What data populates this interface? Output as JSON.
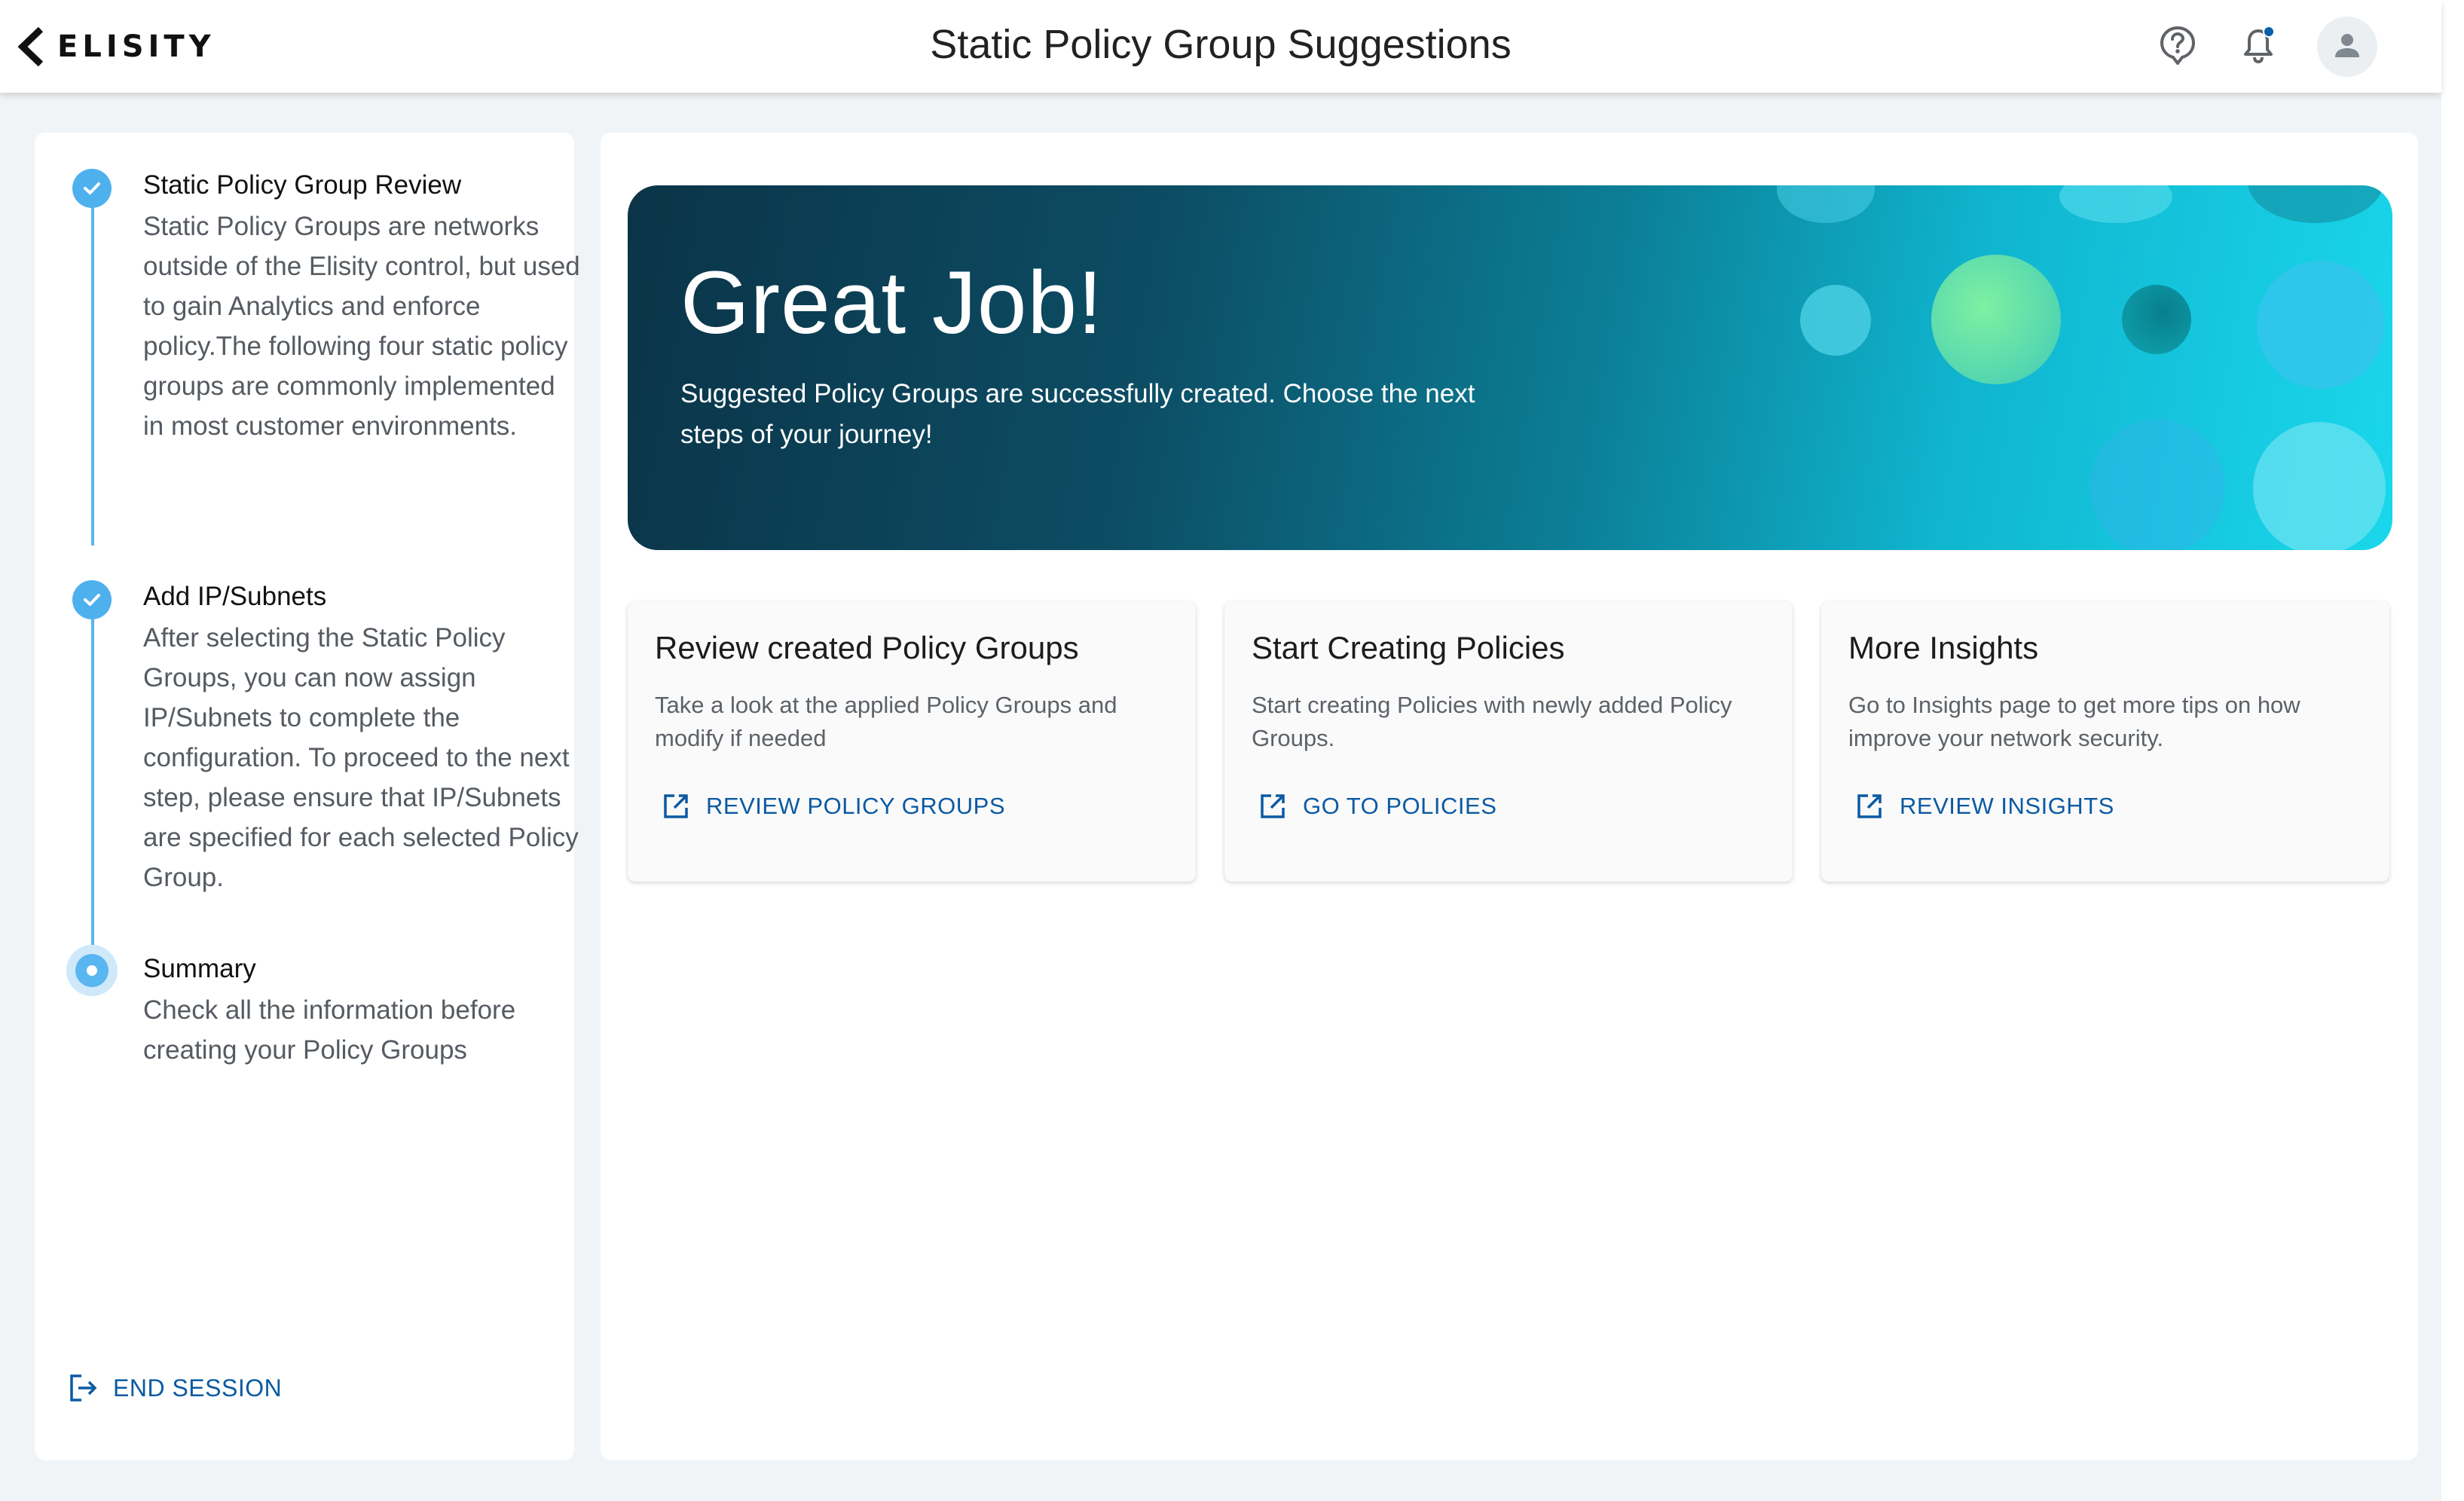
{
  "header": {
    "brand": "ELISITY",
    "title": "Static Policy Group Suggestions",
    "icons": [
      "help-icon",
      "bell-icon",
      "user-avatar-icon"
    ],
    "notification_dot_color": "#0a5fa8"
  },
  "stepper": {
    "steps": [
      {
        "title": "Static Policy Group Review",
        "description": "Static Policy Groups are networks outside of the Elisity control, but used to gain Analytics and enforce policy.The following four static policy groups are commonly implemented in most customer environments.",
        "state": "completed"
      },
      {
        "title": "Add IP/Subnets",
        "description": "After selecting the Static Policy Groups, you can now assign IP/Subnets to complete the configuration. To proceed to the next step, please ensure that IP/Subnets are specified for each selected Policy Group.",
        "state": "completed"
      },
      {
        "title": "Summary",
        "description": "Check all the information before creating your Policy Groups",
        "state": "active"
      }
    ],
    "end_session_label": "END SESSION",
    "accent_color": "#4fb0ee"
  },
  "banner": {
    "title": "Great Job!",
    "subtitle": "Suggested Policy Groups are successfully created. Choose the next steps of your journey!"
  },
  "cards": [
    {
      "title": "Review created Policy Groups",
      "description": "Take a look at the applied Policy Groups and modify if needed",
      "link_label": "REVIEW POLICY GROUPS"
    },
    {
      "title": "Start Creating Policies",
      "description": "Start creating Policies with newly added Policy Groups.",
      "link_label": "GO TO POLICIES"
    },
    {
      "title": "More Insights",
      "description": "Go to Insights page to get more tips on how improve your network security.",
      "link_label": "REVIEW INSIGHTS"
    }
  ],
  "colors": {
    "link": "#0b5aa2",
    "page_bg": "#f1f4f6"
  }
}
